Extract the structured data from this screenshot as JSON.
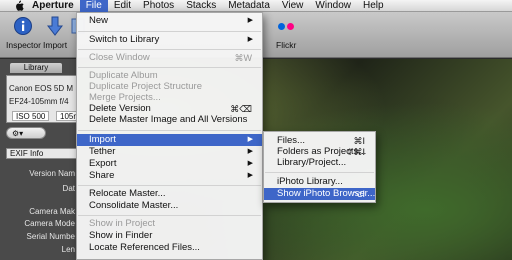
{
  "menubar": {
    "apple_icon": "apple-icon",
    "items": [
      "Aperture",
      "File",
      "Edit",
      "Photos",
      "Stacks",
      "Metadata",
      "View",
      "Window",
      "Help"
    ],
    "active": "File"
  },
  "toolbar": {
    "inspector": "Inspector",
    "import": "Import",
    "flickr": "Flickr"
  },
  "inspector": {
    "library_tab": "Library",
    "camera_model": "Canon EOS 5D M",
    "lens": "EF24-105mm f/4",
    "iso": "ISO 500",
    "focal": "105m",
    "exif_preset": "EXIF Info",
    "labels": {
      "version_name": "Version Nam",
      "date": "Dat",
      "camera_make": "Camera Mak",
      "camera_model": "Camera Mode",
      "serial_number": "Serial Numbe",
      "lens": "Len"
    }
  },
  "file_menu": {
    "items": [
      {
        "label": "New",
        "arrow": "▶"
      },
      {
        "label": "Switch to Library",
        "arrow": "▶"
      },
      {
        "label": "Close Window",
        "shortcut": "⌘W"
      },
      {
        "label": "Duplicate Album"
      },
      {
        "label": "Duplicate Project Structure"
      },
      {
        "label": "Merge Projects..."
      },
      {
        "label": "Delete Version",
        "shortcut": "⌘⌫"
      },
      {
        "label": "Delete Master Image and All Versions"
      },
      {
        "label": "Import",
        "arrow": "▶"
      },
      {
        "label": "Tether",
        "arrow": "▶"
      },
      {
        "label": "Export",
        "arrow": "▶"
      },
      {
        "label": "Share",
        "arrow": "▶"
      },
      {
        "label": "Relocate Master..."
      },
      {
        "label": "Consolidate Master..."
      },
      {
        "label": "Show in Project"
      },
      {
        "label": "Show in Finder"
      },
      {
        "label": "Locate Referenced Files..."
      }
    ]
  },
  "import_submenu": {
    "items": [
      {
        "label": "Files...",
        "shortcut": "⌘I"
      },
      {
        "label": "Folders as Projects...",
        "shortcut": "⇧⌘I"
      },
      {
        "label": "Library/Project..."
      },
      {
        "label": "iPhoto Library..."
      },
      {
        "label": "Show iPhoto Browser...",
        "shortcut": "⌥I"
      }
    ]
  }
}
